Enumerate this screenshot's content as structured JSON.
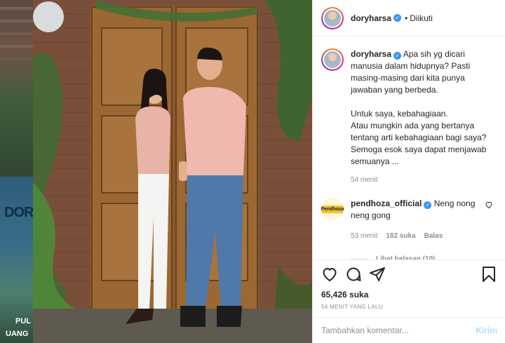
{
  "side_strip": {
    "text_top": "DOR",
    "text_bottom_1": "PUL",
    "text_bottom_2": "UANG"
  },
  "header": {
    "username": "doryharsa",
    "verified_icon": "verified-badge-icon",
    "separator": "•",
    "follow_status": "Diikuti"
  },
  "caption": {
    "username": "doryharsa",
    "text": "Apa sih yg dicari manusia dalam hidupnya? Pasti masing-masing dari kita punya jawaban yang berbeda.\n\nUntuk saya, kebahagiaan.\nAtau mungkin ada yang bertanya tentang arti kebahagiaan bagi saya?\nSemoga esok saya dapat menjawab semuanya ...",
    "time": "54 menit"
  },
  "comment": {
    "avatar_text": "Pendhoza",
    "username": "pendhoza_official",
    "text": "Neng nong neng gong",
    "time": "53 menit",
    "likes": "182 suka",
    "reply": "Balas",
    "view_replies": "Lihat balasan (10)"
  },
  "actions": {
    "icons": [
      "heart-icon",
      "comment-icon",
      "share-icon",
      "bookmark-icon"
    ],
    "likes": "65,426 suka",
    "timestamp": "54 MENIT YANG LALU"
  },
  "comment_box": {
    "placeholder": "Tambahkan komentar...",
    "post_label": "Kirim"
  },
  "colors": {
    "accent_blue": "#3897f0",
    "disabled_post": "#b3dbff",
    "muted_text": "#8e8e8e",
    "border": "#efefef"
  }
}
